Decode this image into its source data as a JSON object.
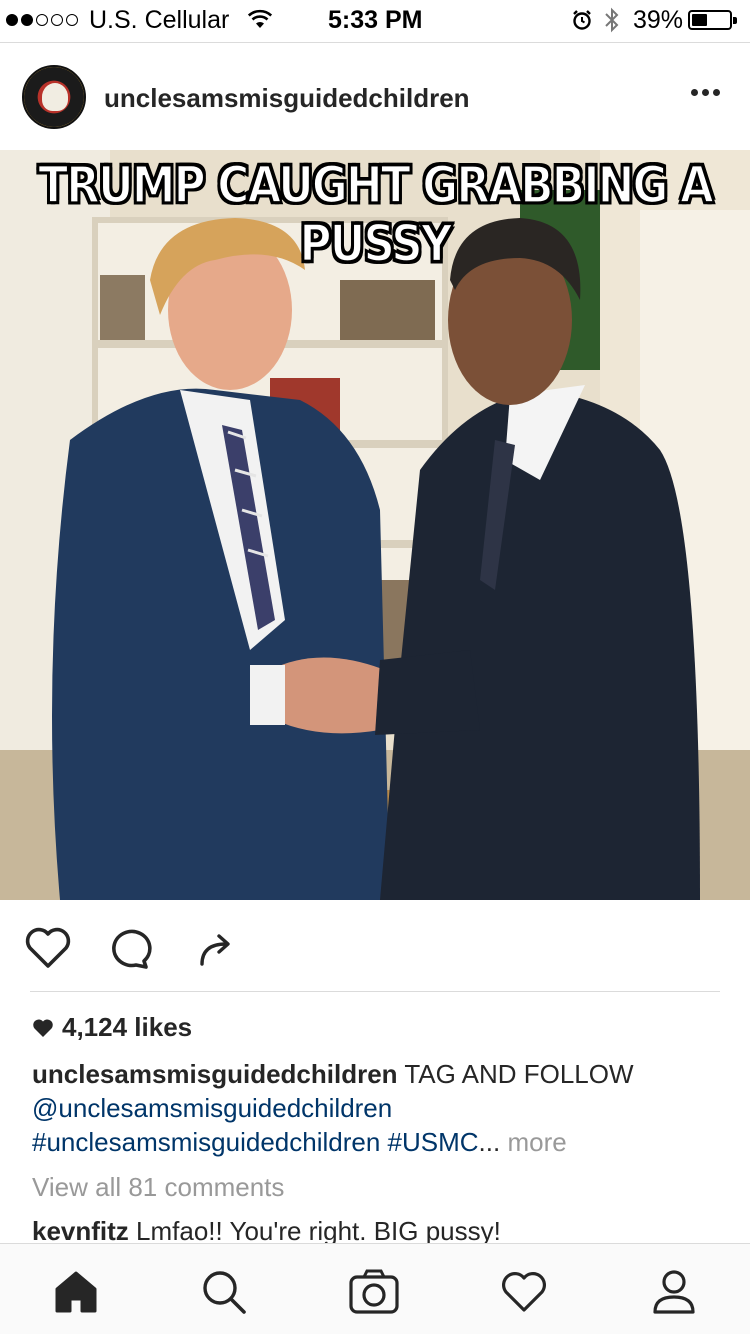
{
  "status_bar": {
    "carrier": "U.S. Cellular",
    "time": "5:33 PM",
    "battery": "39%",
    "signal_bars_filled": 2,
    "signal_bars_total": 5,
    "battery_level": 0.39
  },
  "post": {
    "username": "unclesamsmisguidedchildren",
    "image_caption": "TRUMP CAUGHT GRABBING A PUSSY",
    "likes": "4,124 likes",
    "caption_username": "unclesamsmisguidedchildren",
    "caption_text": " TAG AND FOLLOW ",
    "caption_mention": "@unclesamsmisguidedchildren",
    "caption_hashtag1": "#unclesamsmisguidedchildren",
    "caption_hashtag2": "#USMC",
    "caption_ellipsis": "... ",
    "more_label": "more",
    "view_comments": "View all 81 comments",
    "comment_user": "kevnfitz",
    "comment_text": " Lmfao!! You're right. BIG pussy!"
  },
  "icons": {
    "like": "heart-outline-icon",
    "comment": "speech-bubble-icon",
    "share": "share-arrow-icon",
    "options": "more-dots-icon"
  },
  "tabs": [
    "home",
    "search",
    "camera",
    "activity",
    "profile"
  ],
  "colors": {
    "text": "#262626",
    "link": "#003569",
    "muted": "#999999",
    "divider": "#dbdbdb"
  }
}
